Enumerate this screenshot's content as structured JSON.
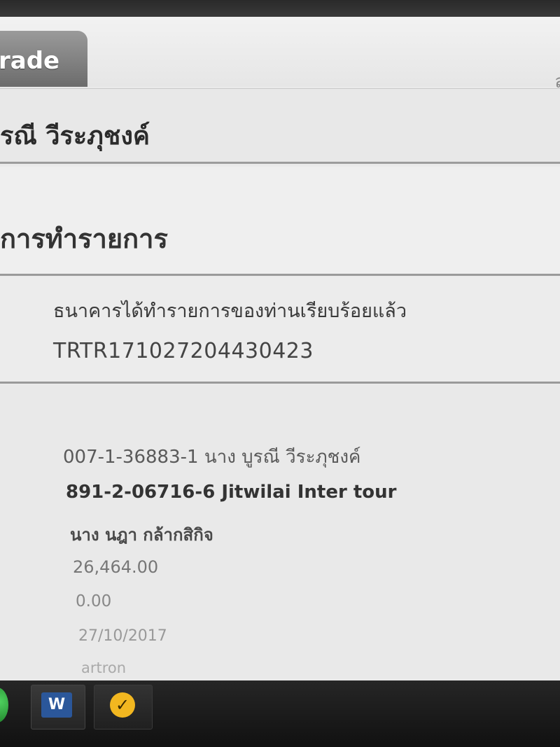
{
  "tabs": {
    "active_label": "rade",
    "right_label": "ล"
  },
  "header": {
    "account_holder": "รณี วีระภุชงค์"
  },
  "section": {
    "title": "การทำรายการ"
  },
  "result": {
    "message": "ธนาคารได้ทำรายการของท่านเรียบร้อยแล้ว",
    "reference": "TRTR171027204430423"
  },
  "details": {
    "from_account": "007-1-36883-1 นาง บูรณี วีระภุชงค์",
    "to_account": "891-2-06716-6 Jitwilai Inter tour",
    "recipient_name": "นาง นฎา กล้ากสิกิจ",
    "amount": "26,464.00",
    "fee": "0.00",
    "date": "27/10/2017",
    "memo": "artron"
  },
  "taskbar": {
    "word_icon_label": "W",
    "norton_icon_label": "✓"
  }
}
